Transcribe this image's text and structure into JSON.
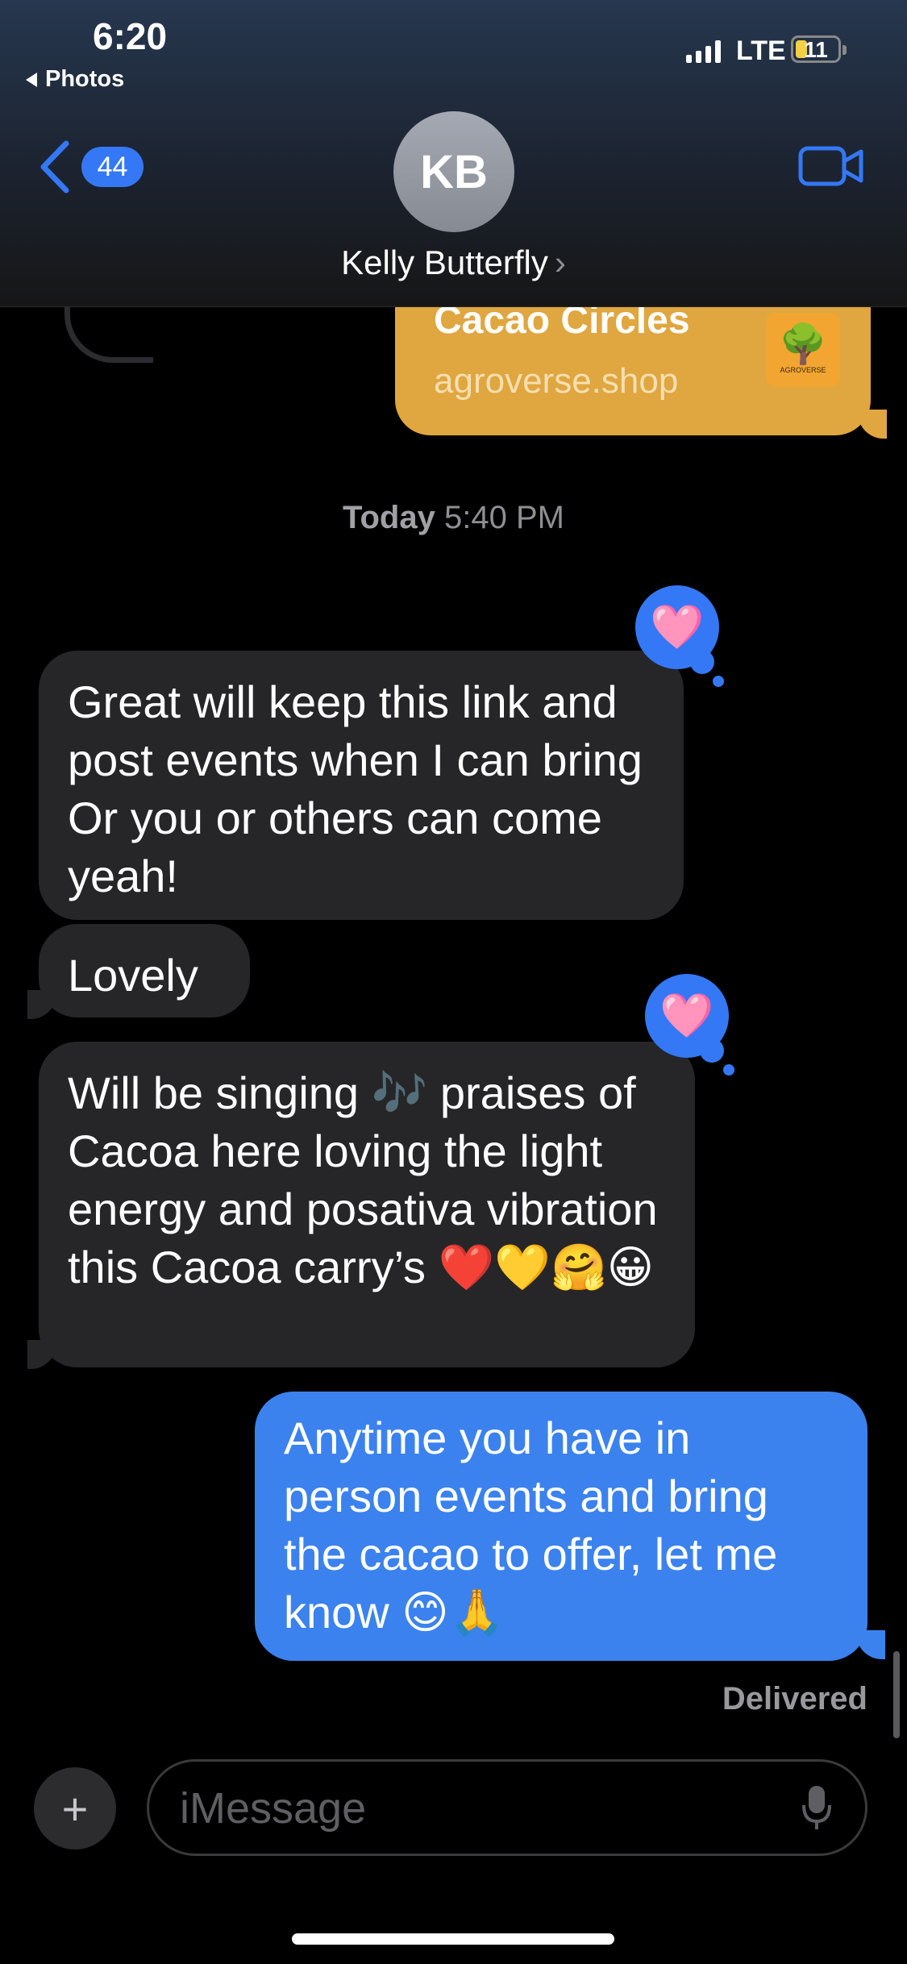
{
  "status": {
    "time": "6:20",
    "back_app": "Photos",
    "network": "LTE",
    "battery": "11"
  },
  "header": {
    "back_count": "44",
    "avatar_initials": "KB",
    "contact_name": "Kelly Butterfly"
  },
  "link_preview": {
    "title": "Cacao Circles",
    "domain": "agroverse.shop",
    "logo_text": "AGROVERSE"
  },
  "timestamp": {
    "day": "Today",
    "time": "5:40 PM"
  },
  "messages": [
    {
      "direction": "incoming",
      "text": "Great will keep this link and post events when I can bring Or you or others can come yeah!",
      "tapback": "🩷"
    },
    {
      "direction": "incoming",
      "text": "Lovely"
    },
    {
      "direction": "incoming",
      "text": "Will be singing 🎶 praises of Cacoa here loving the light energy and posativa vibration this Cacoa carry’s ❤️💛🤗😀",
      "tapback": "🩷"
    },
    {
      "direction": "outgoing",
      "text": "Anytime you have in person events and bring the cacao to offer, let me know 😊🙏"
    }
  ],
  "delivery_status": "Delivered",
  "composer": {
    "placeholder": "iMessage"
  },
  "colors": {
    "imessage_blue": "#3b82ee",
    "incoming_bubble": "#262628",
    "link_card": "#e0a63f"
  }
}
